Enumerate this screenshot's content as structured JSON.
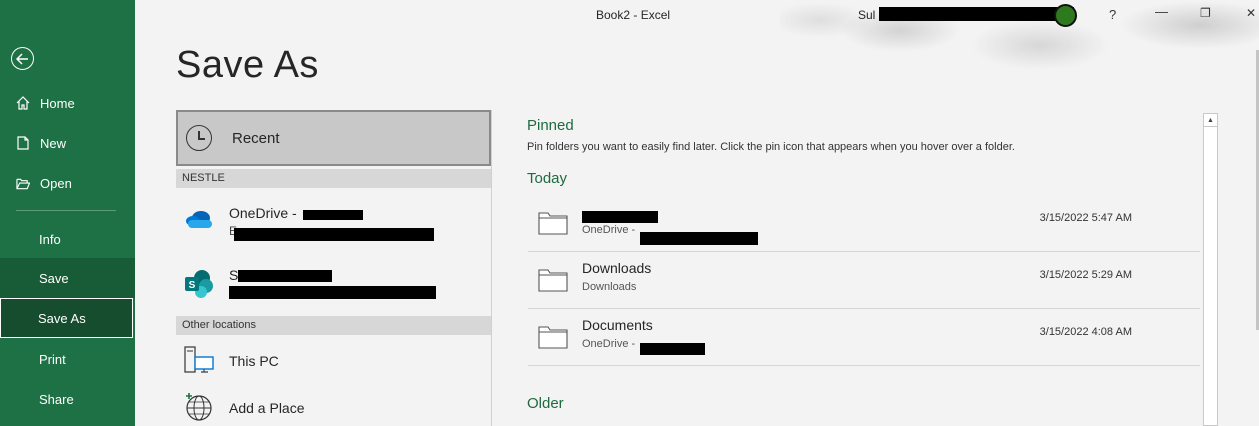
{
  "window": {
    "title": "Book2  -  Excel",
    "user_prefix": "Sul",
    "help": "?",
    "minimize": "—",
    "restore": "❐",
    "close": "✕"
  },
  "nav": {
    "back_icon": "back-arrow-icon",
    "items": [
      {
        "label": "Home",
        "icon": "home-icon"
      },
      {
        "label": "New",
        "icon": "new-file-icon"
      },
      {
        "label": "Open",
        "icon": "open-folder-icon"
      },
      {
        "label": "Info"
      },
      {
        "label": "Save"
      },
      {
        "label": "Save As"
      },
      {
        "label": "Print"
      },
      {
        "label": "Share"
      }
    ]
  },
  "page": {
    "title": "Save As"
  },
  "locations": {
    "recent_label": "Recent",
    "org_header": "NESTLE",
    "onedrive_title": "OneDrive -",
    "onedrive_sub": "E",
    "sharepoint_title": "S",
    "sharepoint_sub": "",
    "other_header": "Other locations",
    "this_pc": "This PC",
    "add_place": "Add a Place"
  },
  "content": {
    "pinned_label": "Pinned",
    "pinned_hint": "Pin folders you want to easily find later. Click the pin icon that appears when you hover over a folder.",
    "today_label": "Today",
    "older_label": "Older",
    "rows": [
      {
        "name": "",
        "path": "OneDrive - ",
        "date": "3/15/2022 5:47 AM"
      },
      {
        "name": "Downloads",
        "path": "Downloads",
        "date": "3/15/2022 5:29 AM"
      },
      {
        "name": "Documents",
        "path": "OneDrive - ",
        "date": "3/15/2022 4:08 AM"
      }
    ]
  },
  "colors": {
    "nav_bg": "#1e7145",
    "accent_text": "#1e6b3f"
  }
}
